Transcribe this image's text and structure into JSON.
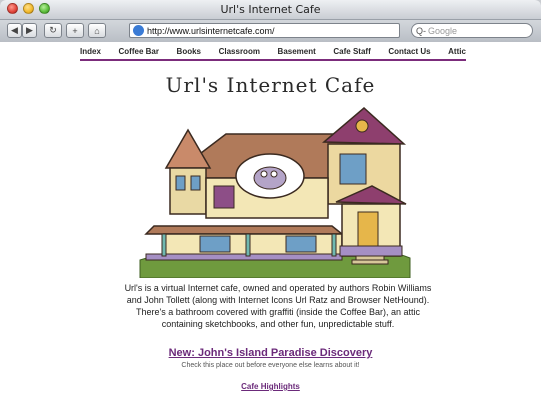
{
  "window": {
    "title": "Url's Internet Cafe"
  },
  "toolbar": {
    "url": "http://www.urlsinternetcafe.com/",
    "search_placeholder": "Google"
  },
  "nav": {
    "items": [
      "Index",
      "Coffee Bar",
      "Books",
      "Classroom",
      "Basement",
      "Cafe Staff",
      "Contact Us",
      "Attic"
    ]
  },
  "page": {
    "title": "Url's Internet Cafe",
    "description": "Url's is a virtual Internet cafe, owned and operated by authors Robin Williams and John Tollett (along with Internet Icons Url Ratz and Browser NetHound). There's a bathroom covered with graffiti (inside the Coffee Bar), an attic containing sketchbooks, and other fun, unpredictable stuff.",
    "new_link": "New: John's Island Paradise Discovery",
    "new_sub": "Check this place out before everyone else learns about it!",
    "highlights": "Cafe Highlights"
  },
  "colors": {
    "nav_rule": "#7b2c7b",
    "link": "#6b2a7a"
  }
}
